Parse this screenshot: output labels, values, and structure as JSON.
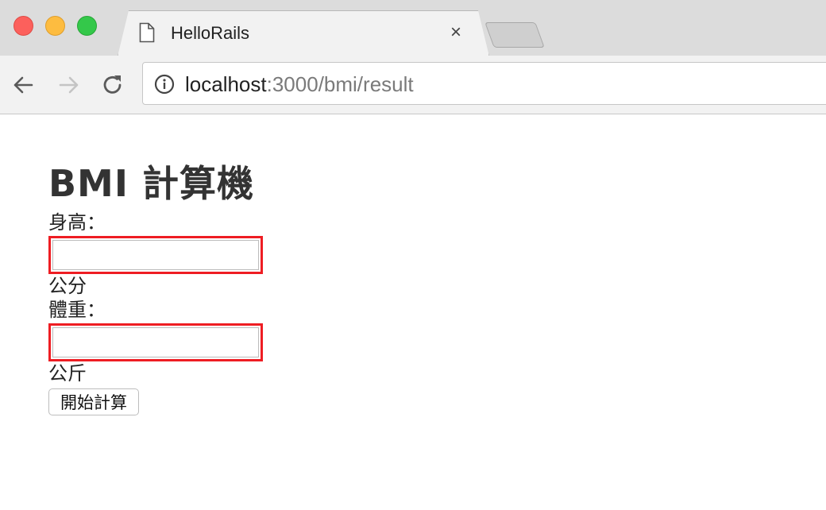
{
  "browser": {
    "tab_title": "HelloRails",
    "close_glyph": "×",
    "url_host": "localhost",
    "url_rest": ":3000/bmi/result"
  },
  "page": {
    "title": "BMI 計算機",
    "height_label": "身高：",
    "height_value": "",
    "height_unit": "公分",
    "weight_label": "體重：",
    "weight_value": "",
    "weight_unit": "公斤",
    "submit_label": "開始計算"
  }
}
